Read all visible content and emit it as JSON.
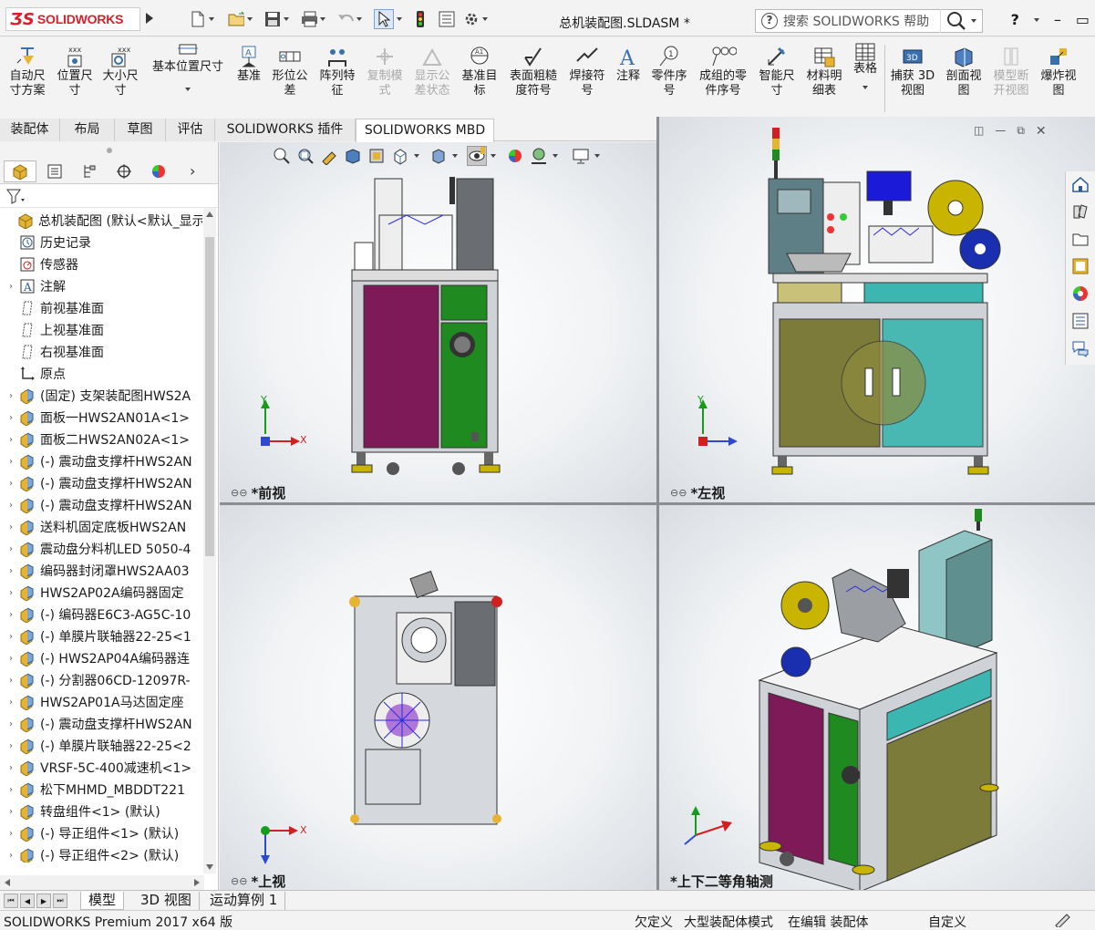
{
  "app": {
    "brand": "SOLIDWORKS",
    "document_title": "总机装配图.SLDASM *"
  },
  "search": {
    "placeholder": "搜索 SOLIDWORKS 帮助"
  },
  "window_buttons": {
    "help": "?",
    "minimize": "–",
    "restore": "▭"
  },
  "command_manager": [
    {
      "label": "自动尺\n寸方案",
      "disabled": false
    },
    {
      "label": "位置尺\n寸",
      "disabled": false
    },
    {
      "label": "大小尺\n寸",
      "disabled": false
    },
    {
      "label": "基本位置尺寸",
      "disabled": false
    },
    {
      "label": "基准",
      "disabled": false
    },
    {
      "label": "形位公\n差",
      "disabled": false
    },
    {
      "label": "阵列特\n征",
      "disabled": false
    },
    {
      "label": "复制模\n式",
      "disabled": true
    },
    {
      "label": "显示公\n差状态",
      "disabled": true
    },
    {
      "label": "基准目\n标",
      "disabled": false
    },
    {
      "label": "表面粗糙\n度符号",
      "disabled": false
    },
    {
      "label": "焊接符\n号",
      "disabled": false
    },
    {
      "label": "注释",
      "disabled": false
    },
    {
      "label": "零件序\n号",
      "disabled": false
    },
    {
      "label": "成组的零\n件序号",
      "disabled": false
    },
    {
      "label": "智能尺\n寸",
      "disabled": false
    },
    {
      "label": "材料明\n细表",
      "disabled": false
    },
    {
      "label": "表格",
      "disabled": false
    },
    {
      "label": "捕获 3D\n视图",
      "disabled": false
    },
    {
      "label": "剖面视\n图",
      "disabled": false
    },
    {
      "label": "模型断\n开视图",
      "disabled": true
    },
    {
      "label": "爆炸视\n图",
      "disabled": false
    }
  ],
  "tabs": [
    "装配体",
    "布局",
    "草图",
    "评估",
    "SOLIDWORKS 插件",
    "SOLIDWORKS MBD"
  ],
  "active_tab": "SOLIDWORKS MBD",
  "tree": [
    {
      "text": "总机装配图 (默认<默认_显示",
      "icon": "assembly",
      "expand": "",
      "indent": 0
    },
    {
      "text": "历史记录",
      "icon": "history",
      "expand": "",
      "indent": 1
    },
    {
      "text": "传感器",
      "icon": "sensor",
      "expand": "",
      "indent": 1
    },
    {
      "text": "注解",
      "icon": "annotation",
      "expand": "›",
      "indent": 1
    },
    {
      "text": "前视基准面",
      "icon": "plane",
      "expand": "",
      "indent": 1
    },
    {
      "text": "上视基准面",
      "icon": "plane",
      "expand": "",
      "indent": 1
    },
    {
      "text": "右视基准面",
      "icon": "plane",
      "expand": "",
      "indent": 1
    },
    {
      "text": "原点",
      "icon": "origin",
      "expand": "",
      "indent": 1
    },
    {
      "text": "(固定) 支架装配图HWS2A",
      "icon": "subassembly",
      "expand": "›",
      "indent": 1
    },
    {
      "text": "面板一HWS2AN01A<1>",
      "icon": "subassembly",
      "expand": "›",
      "indent": 1
    },
    {
      "text": "面板二HWS2AN02A<1>",
      "icon": "subassembly",
      "expand": "›",
      "indent": 1
    },
    {
      "text": "(-) 震动盘支撑杆HWS2AN",
      "icon": "subassembly",
      "expand": "›",
      "indent": 1
    },
    {
      "text": "(-) 震动盘支撑杆HWS2AN",
      "icon": "subassembly",
      "expand": "›",
      "indent": 1
    },
    {
      "text": "(-) 震动盘支撑杆HWS2AN",
      "icon": "subassembly",
      "expand": "›",
      "indent": 1
    },
    {
      "text": "送料机固定底板HWS2AN",
      "icon": "subassembly",
      "expand": "›",
      "indent": 1
    },
    {
      "text": "震动盘分料机LED 5050-4",
      "icon": "subassembly",
      "expand": "›",
      "indent": 1
    },
    {
      "text": "编码器封闭罩HWS2AA03",
      "icon": "subassembly",
      "expand": "›",
      "indent": 1
    },
    {
      "text": "HWS2AP02A编码器固定",
      "icon": "subassembly",
      "expand": "›",
      "indent": 1
    },
    {
      "text": "(-) 编码器E6C3-AG5C-10",
      "icon": "subassembly",
      "expand": "›",
      "indent": 1
    },
    {
      "text": "(-) 单膜片联轴器22-25<1",
      "icon": "subassembly",
      "expand": "›",
      "indent": 1
    },
    {
      "text": "(-) HWS2AP04A编码器连",
      "icon": "subassembly",
      "expand": "›",
      "indent": 1
    },
    {
      "text": "(-) 分割器06CD-12097R-",
      "icon": "subassembly",
      "expand": "›",
      "indent": 1
    },
    {
      "text": "HWS2AP01A马达固定座",
      "icon": "subassembly",
      "expand": "›",
      "indent": 1
    },
    {
      "text": "(-) 震动盘支撑杆HWS2AN",
      "icon": "subassembly",
      "expand": "›",
      "indent": 1
    },
    {
      "text": "(-) 单膜片联轴器22-25<2",
      "icon": "subassembly",
      "expand": "›",
      "indent": 1
    },
    {
      "text": "VRSF-5C-400减速机<1>",
      "icon": "subassembly",
      "expand": "›",
      "indent": 1
    },
    {
      "text": "松下MHMD_MBDDT221",
      "icon": "subassembly",
      "expand": "›",
      "indent": 1
    },
    {
      "text": "转盘组件<1> (默认)",
      "icon": "subassembly",
      "expand": "›",
      "indent": 1
    },
    {
      "text": "(-) 导正组件<1> (默认)",
      "icon": "subassembly",
      "expand": "›",
      "indent": 1
    },
    {
      "text": "(-) 导正组件<2> (默认)",
      "icon": "subassembly",
      "expand": "›",
      "indent": 1
    }
  ],
  "viewports": {
    "front": {
      "label": "*前视"
    },
    "left": {
      "label": "*左视"
    },
    "top": {
      "label": "*上视"
    },
    "iso": {
      "label": "*上下二等角轴测"
    }
  },
  "triad": {
    "x": "X",
    "y": "Y"
  },
  "bottom_tabs": [
    "模型",
    "3D 视图",
    "运动算例 1"
  ],
  "active_bottom_tab": "模型",
  "status": {
    "product": "SOLIDWORKS Premium 2017 x64 版",
    "underdefined": "欠定义",
    "large_assembly": "大型装配体模式",
    "editing": "在编辑 装配体",
    "custom": "自定义"
  },
  "colors": {
    "brand_red": "#d8202a",
    "panel_purple": "#7e1a58",
    "panel_green": "#1f8a1f",
    "panel_teal": "#3bb6b0",
    "panel_olive": "#7c7b3a",
    "frame_gray": "#c9ccd0"
  }
}
